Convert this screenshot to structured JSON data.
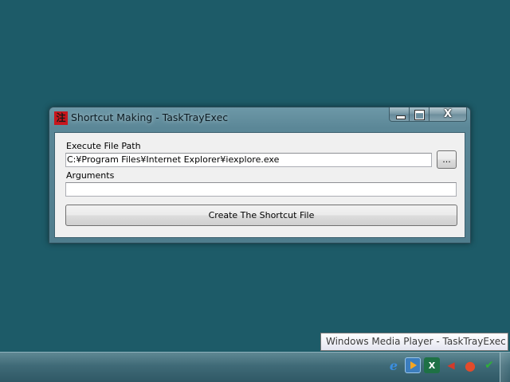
{
  "window": {
    "title": "Shortcut Making - TaskTrayExec",
    "app_icon_glyph": "注",
    "caption": {
      "minimize_glyph": "minimize-icon",
      "maximize_glyph": "maximize-icon",
      "close_glyph": "X"
    }
  },
  "form": {
    "path_label": "Execute File Path",
    "path_value": "C:¥Program Files¥Internet Explorer¥iexplore.exe",
    "browse_label": "...",
    "args_label": "Arguments",
    "args_value": "",
    "create_label": "Create The Shortcut File"
  },
  "tooltip": {
    "text": "Windows Media Player - TaskTrayExec"
  },
  "taskbar": {
    "tray_icons": [
      {
        "name": "internet-explorer-icon",
        "glyph": "e",
        "color": "#3b8ee0"
      },
      {
        "name": "windows-media-player-icon",
        "glyph": "",
        "color": "#f5a623"
      },
      {
        "name": "excel-icon",
        "glyph": "X",
        "color": "#1e7145"
      },
      {
        "name": "volume-icon",
        "glyph": "◀",
        "color": "#d43a2a"
      },
      {
        "name": "chrome-icon",
        "glyph": "●",
        "color": "#e24b2b"
      },
      {
        "name": "security-check-icon",
        "glyph": "✔",
        "color": "#2fae3a"
      }
    ]
  },
  "colors": {
    "desktop": "#1d5b68",
    "taskbar": "#3f6a77"
  }
}
